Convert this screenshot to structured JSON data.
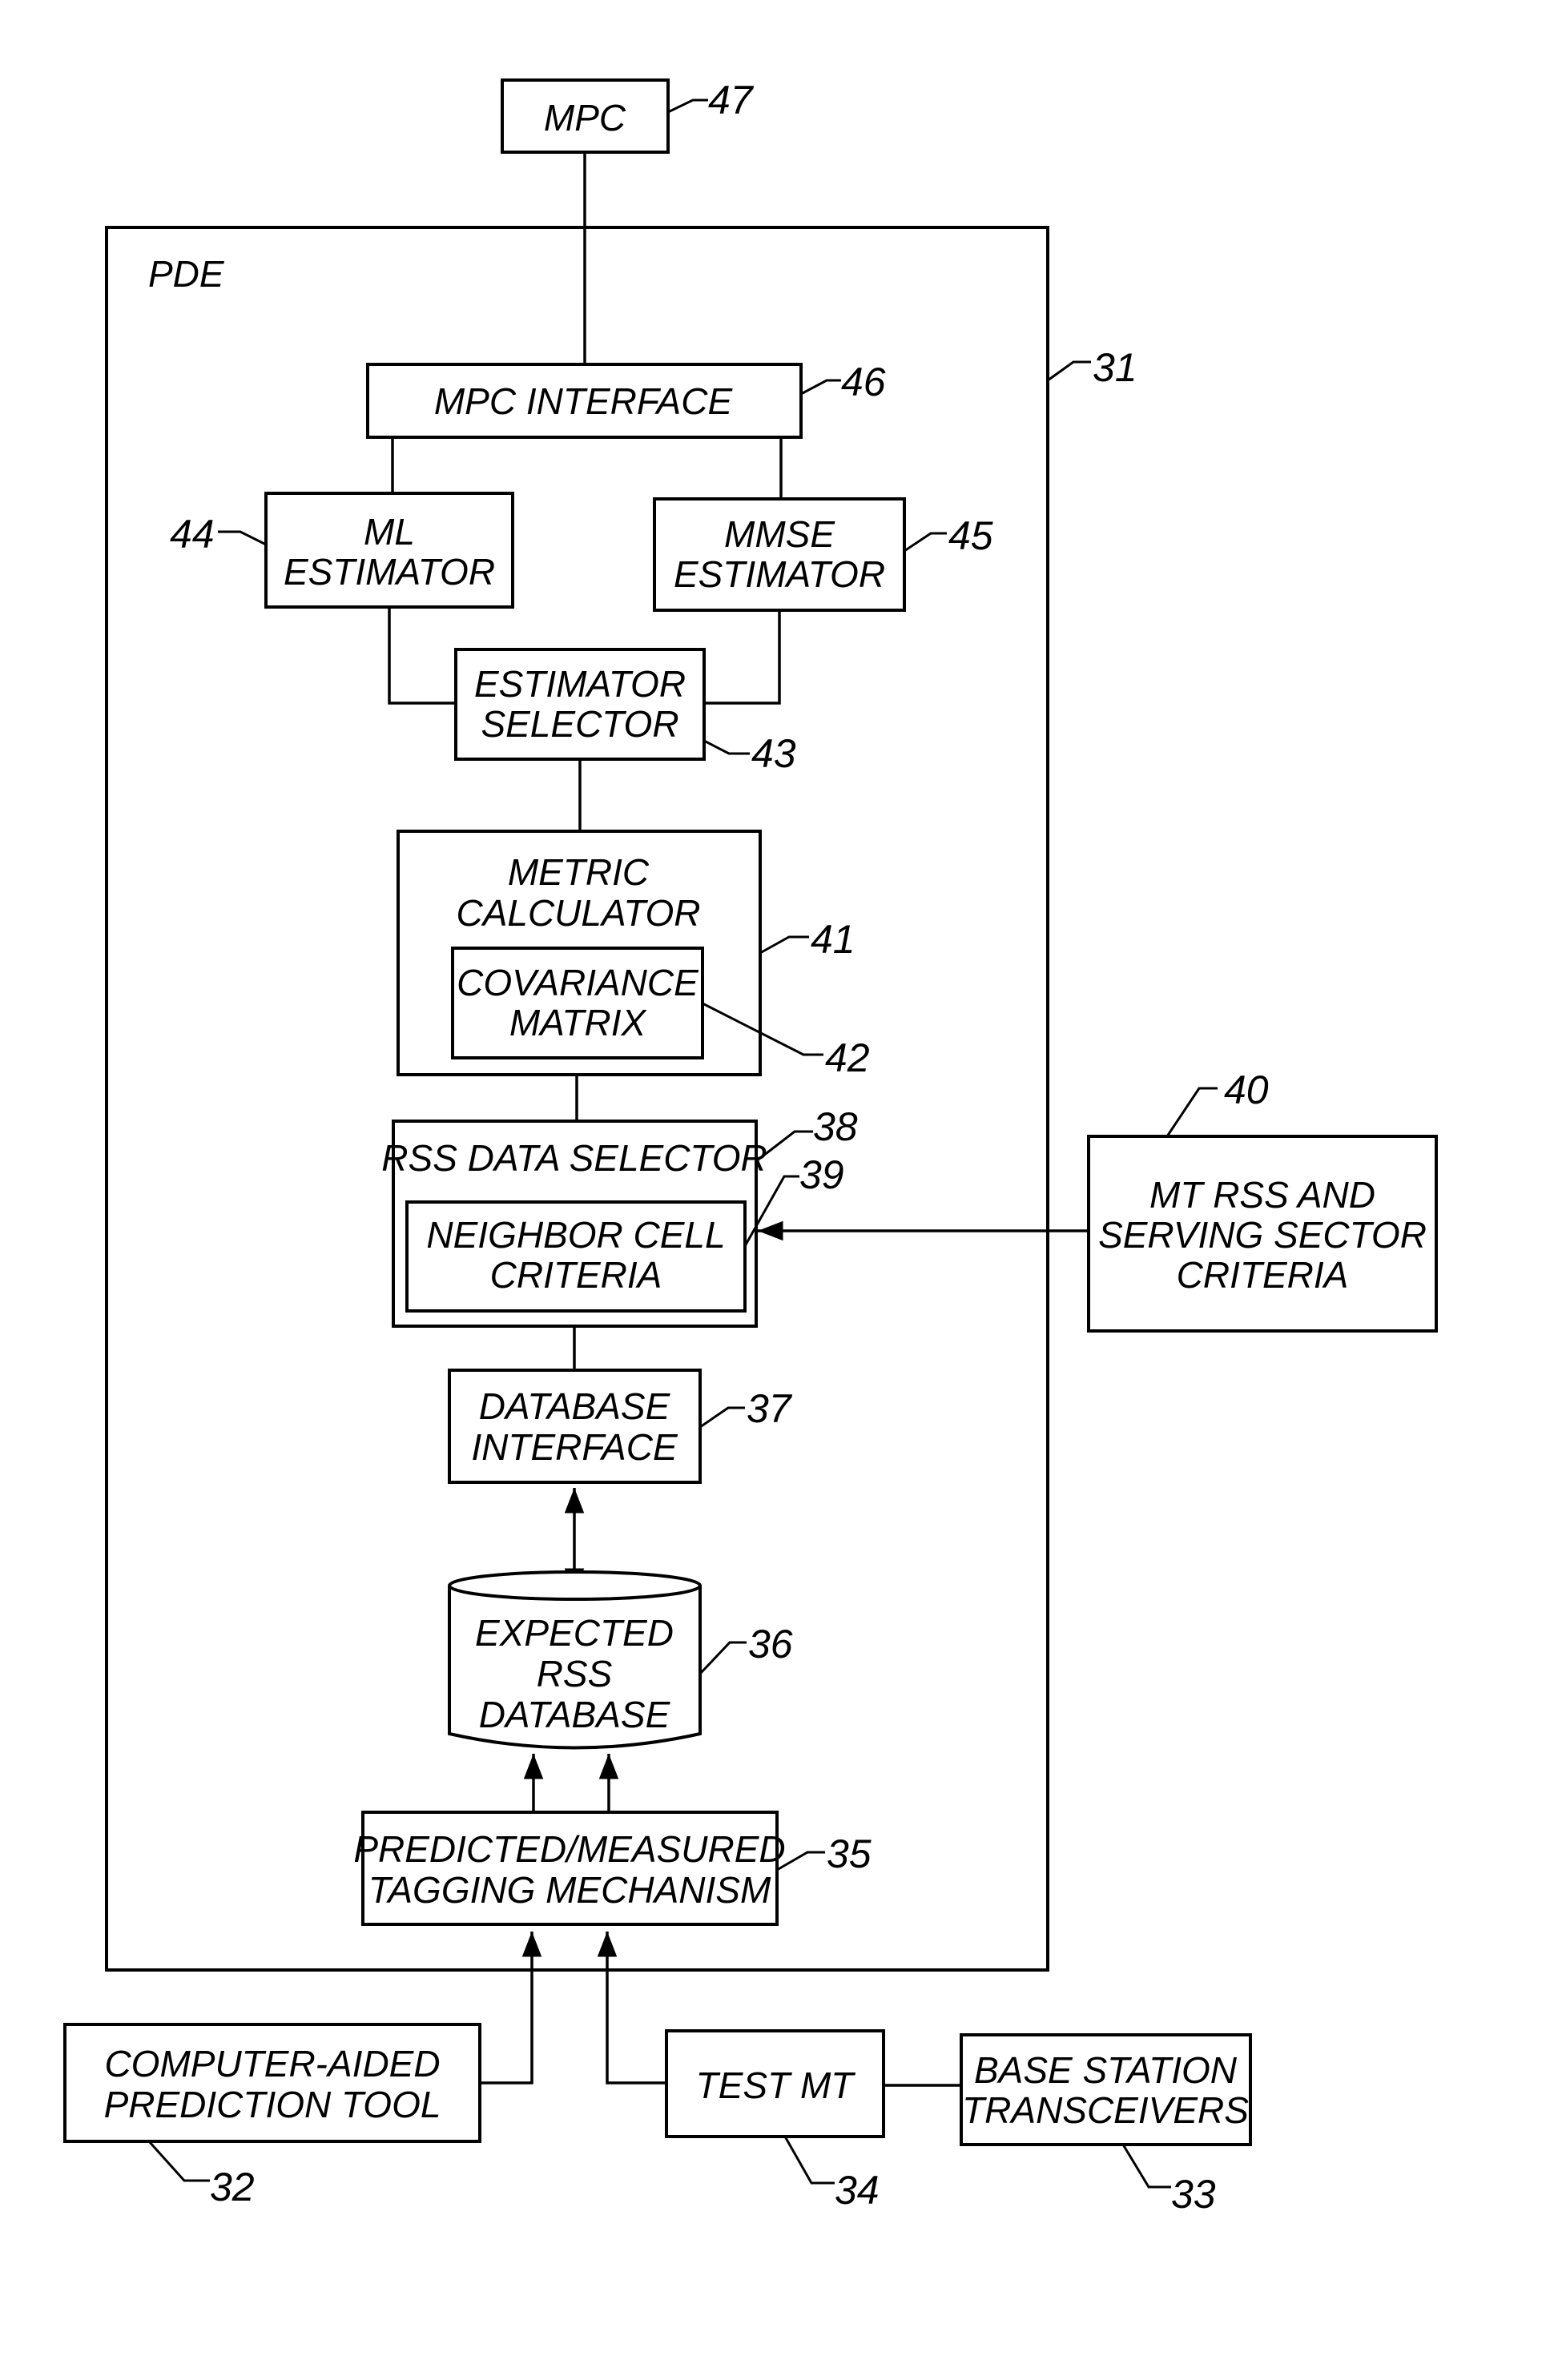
{
  "figure": {
    "container": {
      "label": "PDE",
      "ref": "31"
    },
    "blocks": {
      "mpc": {
        "lines": [
          "MPC"
        ],
        "ref": "47"
      },
      "mpc_interface": {
        "lines": [
          "MPC INTERFACE"
        ],
        "ref": "46"
      },
      "ml_estimator": {
        "lines": [
          "ML",
          "ESTIMATOR"
        ],
        "ref": "44"
      },
      "mmse_estimator": {
        "lines": [
          "MMSE",
          "ESTIMATOR"
        ],
        "ref": "45"
      },
      "estimator_selector": {
        "lines": [
          "ESTIMATOR",
          "SELECTOR"
        ],
        "ref": "43"
      },
      "metric_calculator": {
        "lines": [
          "METRIC",
          "CALCULATOR"
        ],
        "ref": "41"
      },
      "covariance_matrix": {
        "lines": [
          "COVARIANCE",
          "MATRIX"
        ],
        "ref": "42"
      },
      "rss_data_selector": {
        "lines": [
          "RSS DATA SELECTOR"
        ],
        "ref": "38"
      },
      "neighbor_cell_criteria": {
        "lines": [
          "NEIGHBOR CELL",
          "CRITERIA"
        ],
        "ref": "39"
      },
      "database_interface": {
        "lines": [
          "DATABASE",
          "INTERFACE"
        ],
        "ref": "37"
      },
      "expected_rss_database": {
        "lines": [
          "EXPECTED",
          "RSS",
          "DATABASE"
        ],
        "ref": "36"
      },
      "tagging_mechanism": {
        "lines": [
          "PREDICTED/MEASURED",
          "TAGGING MECHANISM"
        ],
        "ref": "35"
      },
      "mt_rss_criteria": {
        "lines": [
          "MT RSS AND",
          "SERVING SECTOR",
          "CRITERIA"
        ],
        "ref": "40"
      },
      "prediction_tool": {
        "lines": [
          "COMPUTER-AIDED",
          "PREDICTION TOOL"
        ],
        "ref": "32"
      },
      "test_mt": {
        "lines": [
          "TEST MT"
        ],
        "ref": "34"
      },
      "base_station_transceivers": {
        "lines": [
          "BASE STATION",
          "TRANSCEIVERS"
        ],
        "ref": "33"
      }
    }
  }
}
